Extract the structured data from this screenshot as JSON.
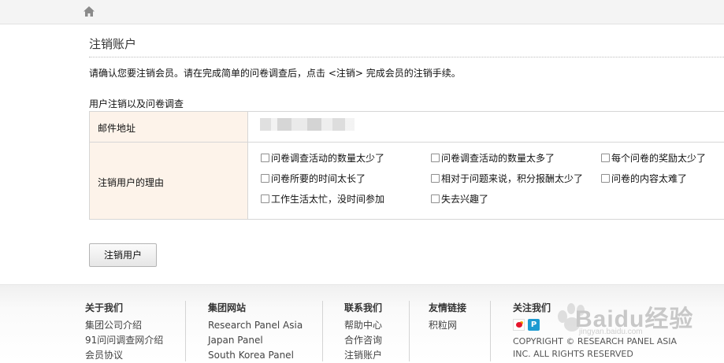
{
  "page": {
    "title": "注销账户",
    "notice": "请确认您要注销会员。请在完成简单的问卷调查后，点击 <注销> 完成会员的注销手续。",
    "section_title": "用户注销以及问卷调查"
  },
  "form": {
    "email_label": "邮件地址",
    "reason_label": "注销用户的理由",
    "reasons": [
      "问卷调查活动的数量太少了",
      "问卷调查活动的数量太多了",
      "每个问卷的奖励太少了",
      "问卷所要的时间太长了",
      "相对于问题来说，积分报酬太少了",
      "问卷的内容太难了",
      "工作生活太忙，没时间参加",
      "失去兴趣了"
    ],
    "submit_label": "注销用户"
  },
  "footer": {
    "about": {
      "heading": "关于我们",
      "links": [
        "集团公司介绍",
        "91问问调查网介绍",
        "会员协议"
      ]
    },
    "group": {
      "heading": "集团网站",
      "links": [
        "Research Panel Asia",
        "Japan Panel",
        "South Korea Panel"
      ]
    },
    "contact": {
      "heading": "联系我们",
      "links": [
        "帮助中心",
        "合作咨询",
        "注销账户"
      ]
    },
    "friends": {
      "heading": "友情链接",
      "links": [
        "积粒网"
      ]
    },
    "follow": {
      "heading": "关注我们",
      "qq_glyph": "P",
      "copyright": "COPYRIGHT © RESEARCH PANEL ASIA INC. ALL RIGHTS RESERVED"
    }
  },
  "watermark": {
    "text": "Baidu经验",
    "url": "jingyan.baidu.com"
  },
  "icons": {
    "home": "home-icon",
    "weibo": "weibo-icon",
    "qq": "qq-icon"
  },
  "colors": {
    "label_bg": "#fdf3ea",
    "border": "#d6d6d6",
    "topbar": "#f4f4f4"
  }
}
